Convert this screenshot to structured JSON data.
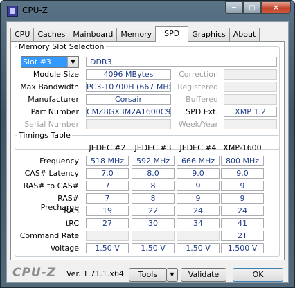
{
  "window": {
    "title": "CPU-Z",
    "minimize_icon": "minimize-icon",
    "maximize_icon": "maximize-icon",
    "close_icon": "close-icon"
  },
  "tabs": [
    {
      "label": "CPU"
    },
    {
      "label": "Caches"
    },
    {
      "label": "Mainboard"
    },
    {
      "label": "Memory"
    },
    {
      "label": "SPD",
      "active": true
    },
    {
      "label": "Graphics"
    },
    {
      "label": "About"
    }
  ],
  "slot": {
    "legend": "Memory Slot Selection",
    "selected": "Slot #3",
    "memory_type": "DDR3",
    "module_size_label": "Module Size",
    "module_size": "4096 MBytes",
    "max_bandwidth_label": "Max Bandwidth",
    "max_bandwidth": "PC3-10700H (667 MHz)",
    "manufacturer_label": "Manufacturer",
    "manufacturer": "Corsair",
    "part_number_label": "Part Number",
    "part_number": "CMZ8GX3M2A1600C9",
    "serial_number_label": "Serial Number",
    "serial_number": "",
    "correction_label": "Correction",
    "correction": "",
    "registered_label": "Registered",
    "registered": "",
    "buffered_label": "Buffered",
    "buffered": "",
    "spd_ext_label": "SPD Ext.",
    "spd_ext": "XMP 1.2",
    "week_year_label": "Week/Year",
    "week_year": ""
  },
  "timings": {
    "legend": "Timings Table",
    "columns": [
      "JEDEC #2",
      "JEDEC #3",
      "JEDEC #4",
      "XMP-1600"
    ],
    "rows": [
      {
        "label": "Frequency",
        "values": [
          "518 MHz",
          "592 MHz",
          "666 MHz",
          "800 MHz"
        ]
      },
      {
        "label": "CAS# Latency",
        "values": [
          "7.0",
          "8.0",
          "9.0",
          "9.0"
        ]
      },
      {
        "label": "RAS# to CAS#",
        "values": [
          "7",
          "8",
          "9",
          "9"
        ]
      },
      {
        "label": "RAS# Precharge",
        "values": [
          "7",
          "8",
          "9",
          "9"
        ]
      },
      {
        "label": "tRAS",
        "values": [
          "19",
          "22",
          "24",
          "24"
        ]
      },
      {
        "label": "tRC",
        "values": [
          "27",
          "30",
          "34",
          "41"
        ]
      },
      {
        "label": "Command Rate",
        "values": [
          "",
          "",
          "",
          "2T"
        ]
      },
      {
        "label": "Voltage",
        "values": [
          "1.50 V",
          "1.50 V",
          "1.50 V",
          "1.500 V"
        ]
      }
    ]
  },
  "footer": {
    "logo": "CPU-Z",
    "version": "Ver. 1.71.1.x64",
    "tools_label": "Tools",
    "validate_label": "Validate",
    "ok_label": "OK"
  }
}
